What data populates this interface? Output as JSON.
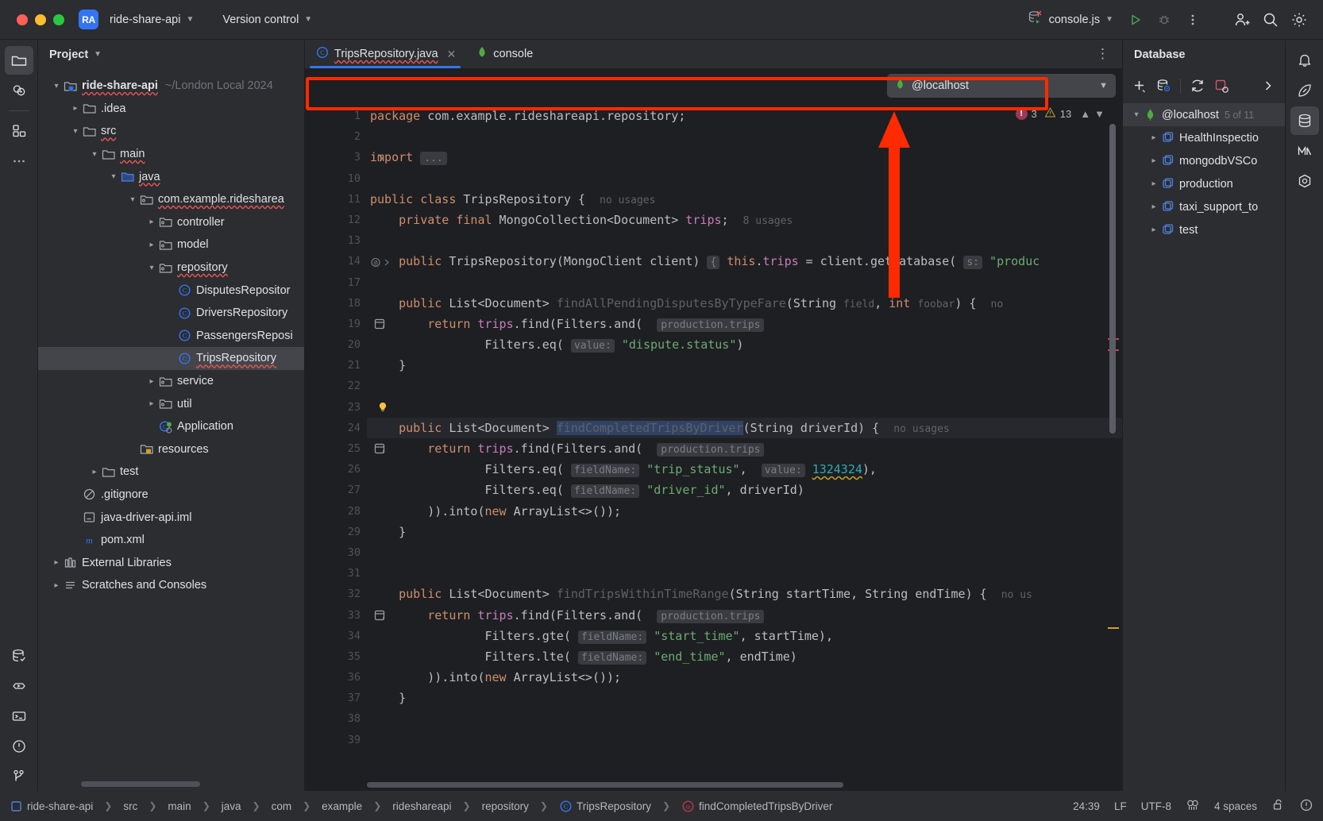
{
  "titlebar": {
    "project_badge": "RA",
    "project_name": "ride-share-api",
    "vcs_label": "Version control",
    "run_config": "console.js",
    "icons": {
      "run": "run-icon",
      "debug": "debug-icon",
      "more": "more-options-icon",
      "account": "add-account-icon",
      "search": "search-icon",
      "settings": "settings-icon"
    }
  },
  "left_rail": [
    {
      "name": "project-tool-window",
      "icon": "folder-icon",
      "active": true
    },
    {
      "name": "commit-tool-window",
      "icon": "commit-icon",
      "active": false
    },
    {
      "name": "structure-tool-window",
      "icon": "structure-icon",
      "active": false
    },
    {
      "name": "more-tool-windows",
      "icon": "ellipsis-icon",
      "active": false
    },
    {
      "name": "database-tool-window",
      "icon": "database-icon",
      "active": false
    },
    {
      "name": "run-tool-window",
      "icon": "run-outline-icon",
      "active": false
    },
    {
      "name": "terminal-tool-window",
      "icon": "terminal-icon",
      "active": false
    },
    {
      "name": "problems-tool-window",
      "icon": "problems-icon",
      "active": false
    },
    {
      "name": "version-control-tool-window",
      "icon": "branch-icon",
      "active": false
    }
  ],
  "project_panel": {
    "title": "Project",
    "tree": [
      {
        "depth": 0,
        "arrow": "down",
        "icon": "module-folder-icon",
        "label": "ride-share-api",
        "sub": "~/London Local 2024",
        "bold": true,
        "err": true
      },
      {
        "depth": 1,
        "arrow": "right",
        "icon": "folder-icon",
        "label": ".idea",
        "sub": "",
        "bold": false,
        "err": false
      },
      {
        "depth": 1,
        "arrow": "down",
        "icon": "folder-icon",
        "label": "src",
        "sub": "",
        "bold": false,
        "err": true
      },
      {
        "depth": 2,
        "arrow": "down",
        "icon": "folder-icon",
        "label": "main",
        "sub": "",
        "bold": false,
        "err": true
      },
      {
        "depth": 3,
        "arrow": "down",
        "icon": "source-folder-icon",
        "label": "java",
        "sub": "",
        "bold": false,
        "err": true
      },
      {
        "depth": 4,
        "arrow": "down",
        "icon": "package-icon",
        "label": "com.example.ridesharea",
        "sub": "",
        "bold": false,
        "err": true
      },
      {
        "depth": 5,
        "arrow": "right",
        "icon": "package-icon",
        "label": "controller",
        "sub": "",
        "bold": false,
        "err": false
      },
      {
        "depth": 5,
        "arrow": "right",
        "icon": "package-icon",
        "label": "model",
        "sub": "",
        "bold": false,
        "err": false
      },
      {
        "depth": 5,
        "arrow": "down",
        "icon": "package-icon",
        "label": "repository",
        "sub": "",
        "bold": false,
        "err": true
      },
      {
        "depth": 6,
        "arrow": "none",
        "icon": "java-class-icon",
        "label": "DisputesRepositor",
        "sub": "",
        "bold": false,
        "err": false
      },
      {
        "depth": 6,
        "arrow": "none",
        "icon": "java-class-icon",
        "label": "DriversRepository",
        "sub": "",
        "bold": false,
        "err": false
      },
      {
        "depth": 6,
        "arrow": "none",
        "icon": "java-class-icon",
        "label": "PassengersReposi",
        "sub": "",
        "bold": false,
        "err": false
      },
      {
        "depth": 6,
        "arrow": "none",
        "icon": "java-class-icon",
        "label": "TripsRepository",
        "sub": "",
        "bold": false,
        "err": true,
        "selected": true
      },
      {
        "depth": 5,
        "arrow": "right",
        "icon": "package-icon",
        "label": "service",
        "sub": "",
        "bold": false,
        "err": false
      },
      {
        "depth": 5,
        "arrow": "right",
        "icon": "package-icon",
        "label": "util",
        "sub": "",
        "bold": false,
        "err": false
      },
      {
        "depth": 5,
        "arrow": "none",
        "icon": "java-runnable-class-icon",
        "label": "Application",
        "sub": "",
        "bold": false,
        "err": false
      },
      {
        "depth": 4,
        "arrow": "none",
        "icon": "resources-folder-icon",
        "label": "resources",
        "sub": "",
        "bold": false,
        "err": false
      },
      {
        "depth": 2,
        "arrow": "right",
        "icon": "folder-icon",
        "label": "test",
        "sub": "",
        "bold": false,
        "err": false
      },
      {
        "depth": 1,
        "arrow": "none",
        "icon": "gitignore-icon",
        "label": ".gitignore",
        "sub": "",
        "bold": false,
        "err": false
      },
      {
        "depth": 1,
        "arrow": "none",
        "icon": "iml-file-icon",
        "label": "java-driver-api.iml",
        "sub": "",
        "bold": false,
        "err": false
      },
      {
        "depth": 1,
        "arrow": "none",
        "icon": "maven-icon",
        "label": "pom.xml",
        "sub": "",
        "bold": false,
        "err": false
      },
      {
        "depth": 0,
        "arrow": "right",
        "icon": "libraries-icon",
        "label": "External Libraries",
        "sub": "",
        "bold": false,
        "err": false
      },
      {
        "depth": 0,
        "arrow": "right",
        "icon": "scratches-icon",
        "label": "Scratches and Consoles",
        "sub": "",
        "bold": false,
        "err": false
      }
    ]
  },
  "editor": {
    "tabs": [
      {
        "label": "TripsRepository.java",
        "icon": "java-class-icon",
        "active": true,
        "closable": true,
        "err": true
      },
      {
        "label": "console",
        "icon": "mongodb-leaf-icon",
        "active": false,
        "closable": false,
        "err": false
      }
    ],
    "datasource_selector": {
      "value": "@localhost",
      "icon": "mongodb-leaf-icon",
      "chevron": "chevron-down-icon"
    },
    "inspections": {
      "error_count": "3",
      "warning_count": "13",
      "prev_icon": "chevron-up-icon",
      "next_icon": "chevron-down-icon"
    },
    "first_line": 1,
    "lines": [
      {
        "n": "1",
        "mark": "",
        "html": "<span class='kw'>package</span> com.example.rideshareapi.repository;"
      },
      {
        "n": "2",
        "mark": "",
        "html": ""
      },
      {
        "n": "3",
        "mark": "fold",
        "html": "<span class='kw'>import</span> <span class='inlay'>...</span>"
      },
      {
        "n": "10",
        "mark": "",
        "html": ""
      },
      {
        "n": "11",
        "mark": "",
        "html": "<span class='kw'>public</span> <span class='kw'>class</span> <span class='cls'>TripsRepository</span> {  <span class='hint-plain'>no usages</span>"
      },
      {
        "n": "12",
        "mark": "",
        "html": "    <span class='kw'>private</span> <span class='kw'>final</span> MongoCollection&lt;Document&gt; <span class='fld'>trips</span>;  <span class='hint-plain'>8 usages</span>"
      },
      {
        "n": "13",
        "mark": "",
        "html": ""
      },
      {
        "n": "14",
        "mark": "annot",
        "html": "    <span class='kw'>public</span> <span class='cls'>TripsRepository</span>(MongoClient client) <span class='hint'>{</span> <span class='kw'>this</span>.<span class='fld'>trips</span> = client.getDatabase( <span class='hint'>s:</span> <span class='str'>\"produc</span>"
      },
      {
        "n": "17",
        "mark": "",
        "html": ""
      },
      {
        "n": "18",
        "mark": "",
        "html": "    <span class='kw'>public</span> List&lt;Document&gt; <span class='fn-dim'>findAllPendingDisputesByTypeFare</span>(String <span class='hint-plain'>field</span>, <span class='kw'>int</span> <span class='hint-plain'>foobar</span>) {  <span class='hint-plain'>no</span>"
      },
      {
        "n": "19",
        "mark": "mongo",
        "html": "        <span class='kw'>return</span> <span class='fld'>trips</span>.find(Filters.<span class='ital'>and</span>(  <span class='inlay'>production.trips</span>"
      },
      {
        "n": "20",
        "mark": "",
        "html": "                Filters.<span class='ital'>eq</span>( <span class='hint'>value:</span> <span class='str'>\"dispute.status\"</span>)"
      },
      {
        "n": "21",
        "mark": "",
        "html": "    }"
      },
      {
        "n": "22",
        "mark": "",
        "html": ""
      },
      {
        "n": "23",
        "mark": "bulb",
        "html": ""
      },
      {
        "n": "24",
        "mark": "",
        "html": "    <span class='kw'>public</span> List&lt;Document&gt; <span class='sel-ident fn-dim'>findCompletedTripsByDriver</span>(String driverId) {  <span class='hint-plain'>no usages</span>",
        "current": true
      },
      {
        "n": "25",
        "mark": "mongo",
        "html": "        <span class='kw'>return</span> <span class='fld'>trips</span>.find(Filters.<span class='ital'>and</span>(  <span class='inlay'>production.trips</span>"
      },
      {
        "n": "26",
        "mark": "",
        "html": "                Filters.<span class='ital'>eq</span>( <span class='hint'>fieldName:</span> <span class='str'>\"trip_status\"</span>,  <span class='hint'>value:</span> <span class='num wavy-num'>1324324</span>),"
      },
      {
        "n": "27",
        "mark": "",
        "html": "                Filters.<span class='ital'>eq</span>( <span class='hint'>fieldName:</span> <span class='str'>\"driver_id\"</span>, driverId)"
      },
      {
        "n": "28",
        "mark": "",
        "html": "        )).into(<span class='kw'>new</span> ArrayList&lt;&gt;());"
      },
      {
        "n": "29",
        "mark": "",
        "html": "    }"
      },
      {
        "n": "30",
        "mark": "",
        "html": ""
      },
      {
        "n": "31",
        "mark": "",
        "html": ""
      },
      {
        "n": "32",
        "mark": "",
        "html": "    <span class='kw'>public</span> List&lt;Document&gt; <span class='fn-dim'>findTripsWithinTimeRange</span>(String startTime, String endTime) {  <span class='hint-plain'>no us</span>"
      },
      {
        "n": "33",
        "mark": "mongo",
        "html": "        <span class='kw'>return</span> <span class='fld'>trips</span>.find(Filters.<span class='ital'>and</span>(  <span class='inlay'>production.trips</span>"
      },
      {
        "n": "34",
        "mark": "",
        "html": "                Filters.<span class='ital'>gte</span>( <span class='hint'>fieldName:</span> <span class='str'>\"start_time\"</span>, startTime),"
      },
      {
        "n": "35",
        "mark": "",
        "html": "                Filters.<span class='ital'>lte</span>( <span class='hint'>fieldName:</span> <span class='str'>\"end_time\"</span>, endTime)"
      },
      {
        "n": "36",
        "mark": "",
        "html": "        )).into(<span class='kw'>new</span> ArrayList&lt;&gt;());"
      },
      {
        "n": "37",
        "mark": "",
        "html": "    }"
      },
      {
        "n": "38",
        "mark": "",
        "html": ""
      },
      {
        "n": "39",
        "mark": "",
        "html": ""
      }
    ]
  },
  "database_panel": {
    "title": "Database",
    "toolbar": [
      {
        "name": "add-data-source-button",
        "icon": "plus-icon"
      },
      {
        "name": "data-source-properties-button",
        "icon": "database-settings-icon"
      },
      {
        "name": "refresh-button",
        "icon": "refresh-icon"
      },
      {
        "name": "stop-refresh-button",
        "icon": "stop-refresh-icon"
      },
      {
        "name": "expand-toolbar-button",
        "icon": "chevron-right-icon"
      }
    ],
    "tree": [
      {
        "depth": 0,
        "arrow": "down",
        "icon": "mongodb-leaf-icon",
        "label": "@localhost",
        "sub": "5 of 11",
        "selected": true
      },
      {
        "depth": 1,
        "arrow": "right",
        "icon": "database-schema-icon",
        "label": "HealthInspectio",
        "sub": ""
      },
      {
        "depth": 1,
        "arrow": "right",
        "icon": "database-schema-icon",
        "label": "mongodbVSCo",
        "sub": ""
      },
      {
        "depth": 1,
        "arrow": "right",
        "icon": "database-schema-icon",
        "label": "production",
        "sub": ""
      },
      {
        "depth": 1,
        "arrow": "right",
        "icon": "database-schema-icon",
        "label": "taxi_support_to",
        "sub": ""
      },
      {
        "depth": 1,
        "arrow": "right",
        "icon": "database-schema-icon",
        "label": "test",
        "sub": ""
      }
    ]
  },
  "right_rail": [
    {
      "name": "notifications-tool-window",
      "icon": "bell-icon"
    },
    {
      "name": "ai-assistant-tool-window",
      "icon": "ai-icon"
    },
    {
      "name": "database-tool-window",
      "icon": "database-icon",
      "active": true
    },
    {
      "name": "maven-tool-window",
      "icon": "maven-m-icon"
    },
    {
      "name": "bean-validation-tool-window",
      "icon": "bean-icon"
    }
  ],
  "statusbar": {
    "breadcrumb": [
      {
        "label": "ride-share-api",
        "icon": "module-icon"
      },
      {
        "label": "src",
        "icon": ""
      },
      {
        "label": "main",
        "icon": ""
      },
      {
        "label": "java",
        "icon": ""
      },
      {
        "label": "com",
        "icon": ""
      },
      {
        "label": "example",
        "icon": ""
      },
      {
        "label": "rideshareapi",
        "icon": ""
      },
      {
        "label": "repository",
        "icon": ""
      },
      {
        "label": "TripsRepository",
        "icon": "java-class-icon"
      },
      {
        "label": "findCompletedTripsByDriver",
        "icon": "method-icon"
      }
    ],
    "caret_position": "24:39",
    "line_separator": "LF",
    "encoding": "UTF-8",
    "indent": "4 spaces",
    "icons": {
      "inspections": "inspections-icon",
      "lock": "unlocked-icon",
      "notifications": "status-notification-icon"
    }
  },
  "annotation": {
    "color": "#ff2a00",
    "box_label": "datasource-selector-row-highlight",
    "arrow_label": "arrow-pointing-to-datasource-selector"
  }
}
